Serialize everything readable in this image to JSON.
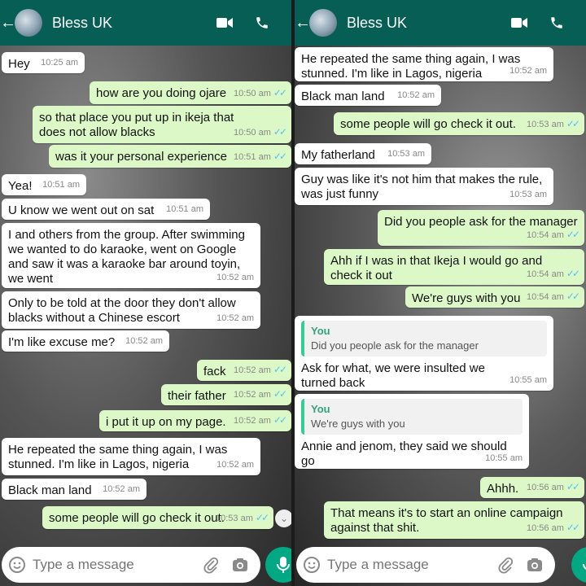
{
  "left": {
    "header": {
      "title": "Bless UK"
    },
    "messages": [
      {
        "dir": "in",
        "text": "Hey",
        "time": "10:25 am"
      },
      {
        "dir": "out",
        "text": "how are you doing ojare",
        "time": "10:50 am"
      },
      {
        "dir": "out",
        "text": "so that place you put up in ikeja that does not allow blacks",
        "time": "10:50 am"
      },
      {
        "dir": "out",
        "text": "was it your personal experience",
        "time": "10:51 am"
      },
      {
        "dir": "in",
        "text": "Yea!",
        "time": "10:51 am"
      },
      {
        "dir": "in",
        "text": "U know we went out on sat",
        "time": "10:51 am"
      },
      {
        "dir": "in",
        "text": "I and others from the group. After swimming we wanted to do karaoke, went on Google and saw it was a karaoke bar around toyin, we went",
        "time": "10:52 am"
      },
      {
        "dir": "in",
        "text": "Only to be told at the door they don't allow blacks without a Chinese escort",
        "time": "10:52 am"
      },
      {
        "dir": "in",
        "text": "I'm like excuse me?",
        "time": "10:52 am"
      },
      {
        "dir": "out",
        "text": "fack",
        "time": "10:52 am"
      },
      {
        "dir": "out",
        "text": "their father",
        "time": "10:52 am"
      },
      {
        "dir": "out",
        "text": "i put it up on my page.",
        "time": "10:52 am"
      },
      {
        "dir": "in",
        "text": "He repeated the same thing again, I was stunned. I'm like in Lagos, nigeria",
        "time": "10:52 am"
      },
      {
        "dir": "in",
        "text": "Black man land",
        "time": "10:52 am"
      },
      {
        "dir": "out",
        "text": "some people will go check it out.",
        "time": "10:53 am"
      }
    ],
    "composer": {
      "placeholder": "Type a message"
    }
  },
  "right": {
    "header": {
      "title": "Bless UK"
    },
    "messages": [
      {
        "dir": "in",
        "text": "He repeated the same thing again, I was stunned. I'm like in Lagos, nigeria",
        "time": "10:52 am"
      },
      {
        "dir": "in",
        "text": "Black man land",
        "time": "10:52 am"
      },
      {
        "dir": "out",
        "text": "some people will go check it out.",
        "time": "10:53 am"
      },
      {
        "dir": "in",
        "text": "My fatherland",
        "time": "10:53 am"
      },
      {
        "dir": "in",
        "text": "Guy was like it's not him that makes the rule, was just funny",
        "time": "10:53 am"
      },
      {
        "dir": "out",
        "text": "Did you people ask for the manager",
        "time": "10:54 am"
      },
      {
        "dir": "out",
        "text": "Ahh if I was in that Ikeja I would go and check it out",
        "time": "10:54 am"
      },
      {
        "dir": "out",
        "text": "We're guys with you",
        "time": "10:54 am"
      },
      {
        "dir": "in",
        "quote_name": "You",
        "quote_text": "Did you people ask for the manager",
        "text": "Ask for what, we were insulted we turned back",
        "time": "10:55 am"
      },
      {
        "dir": "in",
        "quote_name": "You",
        "quote_text": "We're guys with you",
        "text": "Annie and jenom, they said we should go",
        "time": "10:55 am"
      },
      {
        "dir": "out",
        "text": "Ahhh.",
        "time": "10:56 am"
      },
      {
        "dir": "out",
        "text": "That means it's to start an online campaign against that shit.",
        "time": "10:56 am"
      }
    ],
    "composer": {
      "placeholder": "Type a message"
    }
  },
  "colors": {
    "header": "#075e54",
    "outgoing": "#dcf8c6",
    "incoming": "#ffffff",
    "tick": "#4fc3f7",
    "mic": "#00a884"
  },
  "icons": {
    "video": "video-camera-icon",
    "call": "phone-icon",
    "menu": "more-vertical-icon",
    "emoji": "emoji-icon",
    "attach": "paperclip-icon",
    "camera": "camera-icon",
    "mic": "microphone-icon"
  }
}
